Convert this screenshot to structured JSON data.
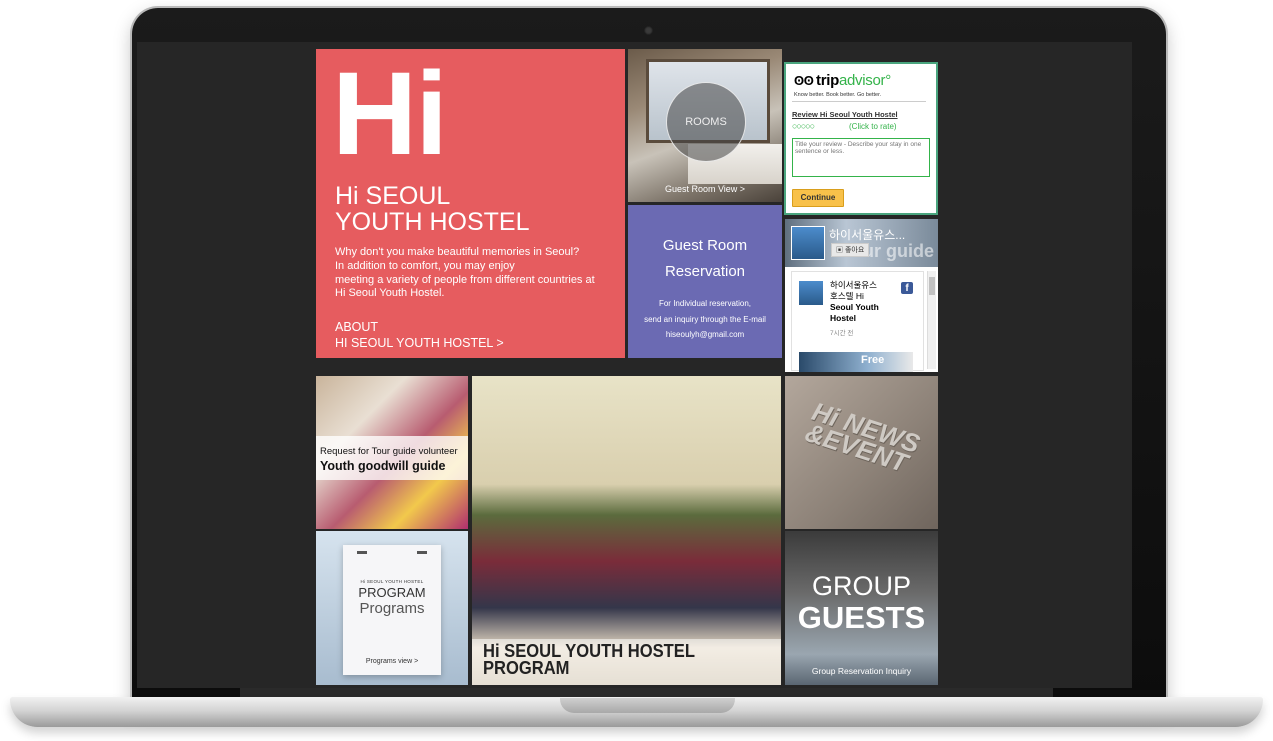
{
  "hero": {
    "big": "Hi",
    "title_line1": "Hi SEOUL",
    "title_line2": "YOUTH HOSTEL",
    "desc1": "Why don't you make beautiful memories in Seoul?",
    "desc2": "In addition to comfort, you may enjoy",
    "desc3": "meeting a variety of people from different countries at",
    "desc4": "Hi Seoul Youth Hostel.",
    "about1": "ABOUT",
    "about2": "HI SEOUL YOUTH HOSTEL >"
  },
  "rooms": {
    "circle_label": "ROOMS",
    "caption": "Guest Room View >"
  },
  "reservation": {
    "heading1": "Guest Room",
    "heading2": "Reservation",
    "line1": "For Individual reservation,",
    "line2": "send an inquiry through the E-mail",
    "email": "hiseoulyh@gmail.com"
  },
  "tripadvisor": {
    "owl": "ʘʘ",
    "brand_trip": "trip",
    "brand_advisor": "advisor",
    "tm": "°",
    "slogan": "Know better. Book better. Go better.",
    "review_link": "Review Hi Seoul Youth Hostel",
    "bubbles": "○○○○○",
    "click_to_rate": "(Click to rate)",
    "textarea_placeholder": "Title your review - Describe your stay in one sentence or less.",
    "continue": "Continue"
  },
  "facebook": {
    "page_name": "하이서울유스...",
    "cover_text": "Tour guide",
    "like": "좋아요",
    "post_title_1": "하이서울유스",
    "post_title_2": "호스텔 Hi",
    "post_title_3": "Seoul Youth",
    "post_title_4": "Hostel",
    "fb_logo": "f",
    "time": "7시간 전",
    "thumb_text": "Free"
  },
  "youth_guide": {
    "line1": "Request for Tour guide volunteer",
    "line2": "Youth goodwill guide"
  },
  "program": {
    "poster_small": "Hi SEOUL YOUTH HOSTEL",
    "poster_big1": "PROGRAM",
    "poster_big2": "Programs",
    "view": "Programs view >"
  },
  "group_photo": {
    "caption1": "Hi SEOUL YOUTH HOSTEL",
    "caption2": "PROGRAM"
  },
  "news": {
    "line1": "Hi NEWS",
    "line2": "&EVENT"
  },
  "group_guests": {
    "line1": "GROUP",
    "line2": "GUESTS",
    "link": "Group Reservation Inquiry"
  }
}
